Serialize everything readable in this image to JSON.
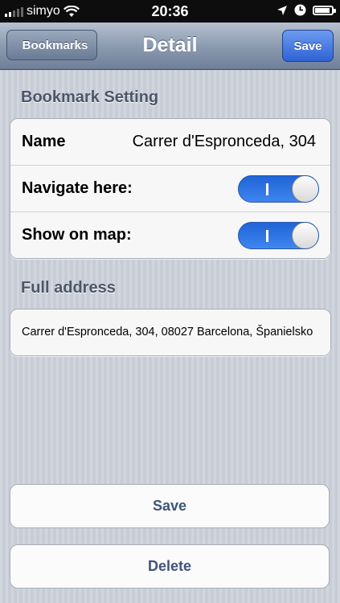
{
  "status_bar": {
    "carrier": "simyo",
    "time": "20:36",
    "icons": [
      "signal-icon",
      "wifi-icon",
      "location-arrow-icon",
      "clock-icon",
      "battery-icon"
    ]
  },
  "nav": {
    "back_label": "Bookmarks",
    "title": "Detail",
    "save_label": "Save"
  },
  "bookmark_setting": {
    "header": "Bookmark Setting",
    "name_label": "Name",
    "name_value": "Carrer d'Espronceda, 304",
    "navigate_label": "Navigate here:",
    "navigate_on": true,
    "show_map_label": "Show on map:",
    "show_map_on": true
  },
  "full_address": {
    "header": "Full address",
    "value": "Carrer d'Espronceda, 304, 08027 Barcelona, Španielsko"
  },
  "actions": {
    "save_label": "Save",
    "delete_label": "Delete"
  },
  "colors": {
    "nav_save": "#3b6fe0",
    "toggle_on": "#2f74e6",
    "action_text": "#3f5478"
  }
}
